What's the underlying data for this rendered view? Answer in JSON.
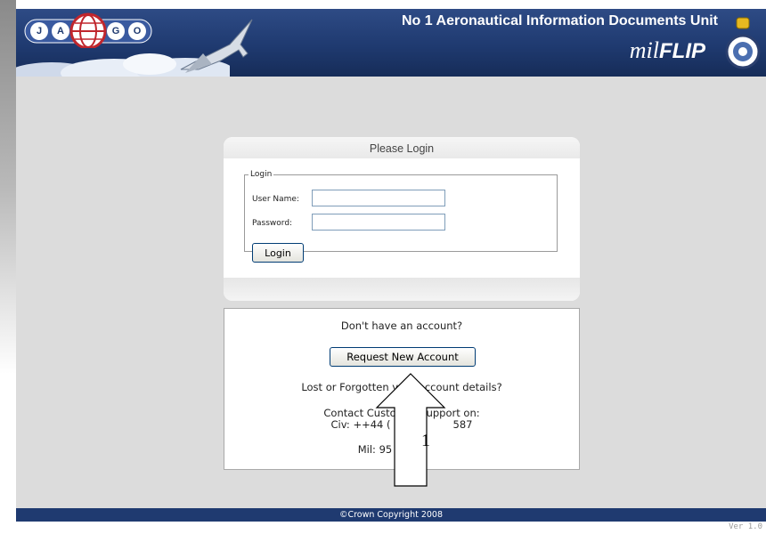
{
  "header": {
    "logo_letters": [
      "J",
      "A",
      "G",
      "O"
    ],
    "title": "No 1 Aeronautical Information Documents Unit",
    "brand_prefix": "mil",
    "brand_suffix": "FLIP"
  },
  "login_panel": {
    "title": "Please Login",
    "legend": "Login",
    "username_label": "User Name:",
    "username_value": "",
    "password_label": "Password:",
    "password_value": "",
    "login_button": "Login"
  },
  "account_panel": {
    "no_account_text": "Don't have an account?",
    "request_button": "Request New Account",
    "lost_text": "Lost or Forgotten your account details?",
    "contact_text": "Contact Customer Support on:",
    "civ_text": "Civ: ++44 (",
    "civ_text_tail": "587",
    "mil_text": "Mil: 95"
  },
  "footer": {
    "copyright": "©Crown Copyright 2008"
  },
  "version": "Ver 1.0",
  "annotation": {
    "number": "1"
  },
  "colors": {
    "header_blue": "#1f3a70",
    "page_gray": "#dcdcdc",
    "input_border": "#7f9db9"
  }
}
